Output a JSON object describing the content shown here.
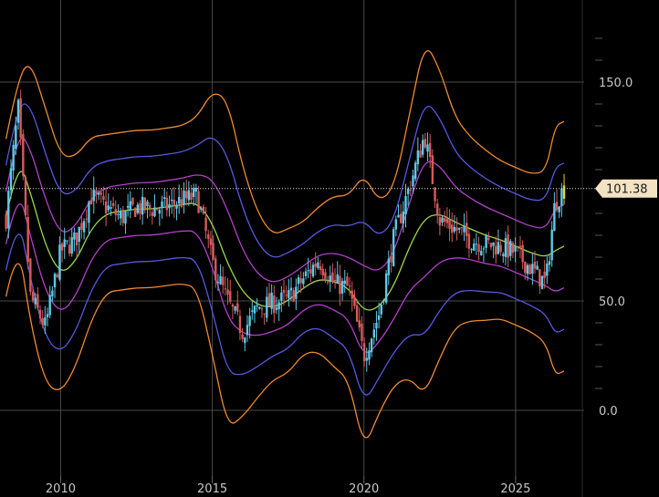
{
  "chart_data": {
    "type": "line",
    "subtype": "candlestick with bollinger-style bands",
    "title": "",
    "xlabel": "",
    "ylabel": "",
    "xlim": [
      2008.0,
      2026.9
    ],
    "ylim": [
      -20,
      180
    ],
    "x_ticks": [
      "2010",
      "2015",
      "2020",
      "2025"
    ],
    "y_ticks": [
      "150.0",
      "50.0",
      "0.0"
    ],
    "grid": true,
    "current_price": "101.38",
    "colors": {
      "background": "#000000",
      "grid": "#4a4a4a",
      "candle": "#5ec8e8",
      "candle_down": "#d85a5a",
      "mid": "#9ad64a",
      "band1": "#b040c8",
      "band2": "#5858e0",
      "band3": "#f08a30",
      "price_line": "#e0e0e0",
      "price_tag": "#f3e3c3",
      "last_bar": "#e8d43a"
    },
    "x": [
      2008.2,
      2008.6,
      2009.0,
      2009.5,
      2010.0,
      2010.5,
      2011.0,
      2011.5,
      2012.0,
      2012.5,
      2013.0,
      2013.5,
      2014.0,
      2014.5,
      2015.0,
      2015.5,
      2016.0,
      2016.5,
      2017.0,
      2017.5,
      2018.0,
      2018.5,
      2019.0,
      2019.5,
      2020.0,
      2020.5,
      2021.0,
      2021.5,
      2022.0,
      2022.5,
      2023.0,
      2023.5,
      2024.0,
      2024.5,
      2025.0,
      2025.5,
      2026.0,
      2026.3,
      2026.6
    ],
    "series": [
      {
        "name": "price",
        "values": [
          88,
          138,
          52,
          38,
          73,
          78,
          98,
          93,
          88,
          93,
          92,
          93,
          96,
          98,
          68,
          50,
          36,
          47,
          49,
          51,
          60,
          69,
          58,
          56,
          25,
          44,
          80,
          102,
          126,
          87,
          83,
          78,
          76,
          75,
          72,
          65,
          58,
          95,
          101.38
        ]
      },
      {
        "name": "mid",
        "values": [
          88,
          115,
          100,
          75,
          62,
          68,
          83,
          90,
          91,
          92,
          92,
          93,
          94,
          95,
          86,
          67,
          54,
          48,
          47,
          50,
          56,
          60,
          59,
          56,
          45,
          47,
          57,
          75,
          88,
          90,
          86,
          83,
          80,
          78,
          75,
          72,
          70,
          73,
          75
        ]
      },
      {
        "name": "upper-1",
        "values": [
          100,
          128,
          120,
          96,
          80,
          84,
          97,
          102,
          103,
          104,
          104,
          105,
          106,
          108,
          106,
          92,
          73,
          62,
          58,
          61,
          66,
          71,
          72,
          70,
          66,
          63,
          72,
          95,
          115,
          112,
          102,
          97,
          93,
          90,
          87,
          84,
          83,
          92,
          94
        ]
      },
      {
        "name": "lower-1",
        "values": [
          76,
          102,
          80,
          54,
          44,
          52,
          69,
          78,
          79,
          80,
          80,
          81,
          82,
          82,
          66,
          42,
          35,
          34,
          36,
          39,
          46,
          49,
          46,
          42,
          24,
          31,
          42,
          55,
          61,
          68,
          70,
          69,
          67,
          66,
          63,
          60,
          57,
          54,
          56
        ]
      },
      {
        "name": "upper-2",
        "values": [
          112,
          140,
          140,
          117,
          98,
          100,
          111,
          114,
          115,
          116,
          116,
          117,
          118,
          121,
          126,
          117,
          92,
          76,
          69,
          72,
          76,
          82,
          85,
          84,
          87,
          79,
          87,
          115,
          142,
          134,
          118,
          111,
          106,
          102,
          99,
          96,
          96,
          111,
          113
        ]
      },
      {
        "name": "lower-2",
        "values": [
          64,
          90,
          60,
          33,
          26,
          36,
          55,
          66,
          67,
          68,
          68,
          69,
          70,
          69,
          46,
          17,
          16,
          20,
          25,
          28,
          36,
          38,
          33,
          28,
          3,
          15,
          27,
          35,
          34,
          46,
          54,
          55,
          54,
          54,
          51,
          48,
          44,
          35,
          37
        ]
      },
      {
        "name": "upper-3",
        "values": [
          124,
          152,
          160,
          138,
          116,
          116,
          125,
          126,
          127,
          128,
          128,
          129,
          130,
          134,
          146,
          142,
          111,
          90,
          80,
          83,
          86,
          93,
          98,
          98,
          108,
          95,
          102,
          135,
          169,
          156,
          134,
          125,
          119,
          114,
          111,
          108,
          109,
          130,
          132
        ]
      },
      {
        "name": "lower-3",
        "values": [
          52,
          78,
          40,
          12,
          8,
          20,
          41,
          54,
          55,
          56,
          56,
          57,
          58,
          56,
          26,
          -8,
          -3,
          6,
          14,
          17,
          26,
          27,
          20,
          14,
          -18,
          -1,
          12,
          15,
          7,
          24,
          38,
          41,
          41,
          42,
          39,
          36,
          31,
          16,
          18
        ]
      }
    ]
  }
}
